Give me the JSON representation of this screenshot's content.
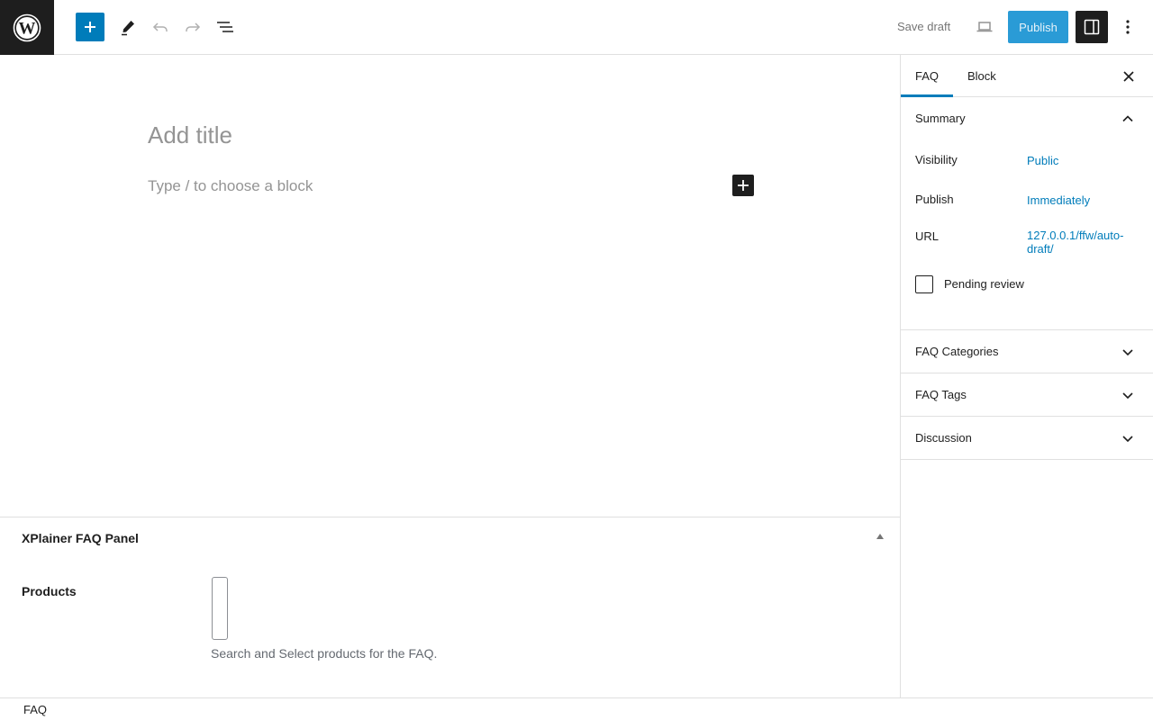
{
  "toolbar": {
    "logo_icon": "wordpress-logo-icon",
    "add_block_icon": "plus-icon",
    "tools_icon": "pencil-icon",
    "undo_icon": "undo-icon",
    "redo_icon": "redo-icon",
    "list_view_icon": "list-view-icon",
    "save_draft_label": "Save draft",
    "preview_icon": "laptop-icon",
    "publish_label": "Publish",
    "settings_icon": "sidebar-toggle-icon",
    "options_icon": "vertical-ellipsis-icon",
    "accent_color": "#007cba"
  },
  "editor": {
    "title_placeholder": "Add title",
    "block_placeholder": "Type / to choose a block"
  },
  "metabox": {
    "title": "XPlainer FAQ Panel",
    "products_label": "Products",
    "products_help": "Search and Select products for the FAQ."
  },
  "footer": {
    "breadcrumb": "FAQ"
  },
  "sidebar": {
    "tabs": [
      {
        "label": "FAQ",
        "active": true
      },
      {
        "label": "Block",
        "active": false
      }
    ],
    "summary": {
      "title": "Summary",
      "expanded": true,
      "visibility_label": "Visibility",
      "visibility_value": "Public",
      "publish_label": "Publish",
      "publish_value": "Immediately",
      "url_label": "URL",
      "url_value": "127.0.0.1/ffw/auto-draft/",
      "pending_review_label": "Pending review",
      "pending_review_checked": false
    },
    "panels": [
      {
        "title": "FAQ Categories",
        "expanded": false
      },
      {
        "title": "FAQ Tags",
        "expanded": false
      },
      {
        "title": "Discussion",
        "expanded": false
      }
    ]
  }
}
